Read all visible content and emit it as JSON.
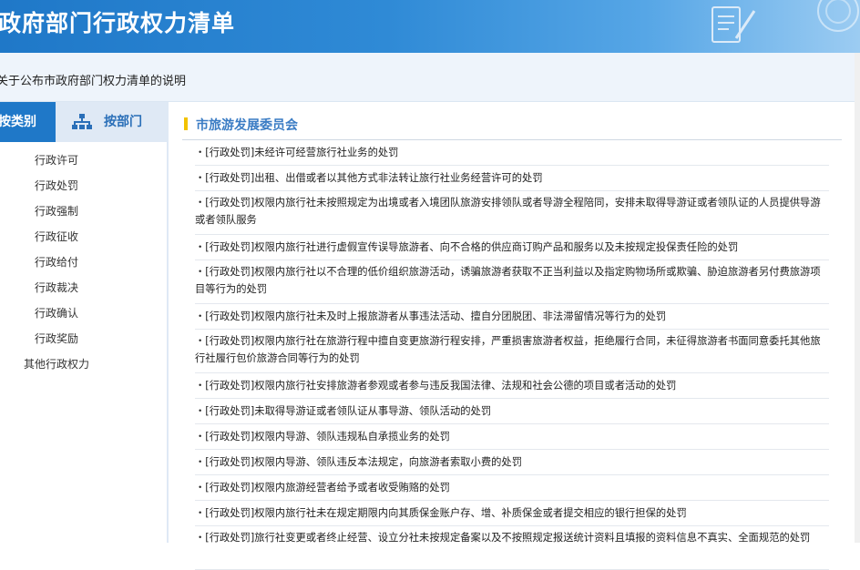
{
  "header": {
    "title": "政府部门行政权力清单"
  },
  "notice": {
    "link_text": "关于公布市政府部门权力清单的说明"
  },
  "tabs": {
    "by_category": "按类别",
    "by_department": "按部门"
  },
  "nav": {
    "items": [
      {
        "label": "行政许可"
      },
      {
        "label": "行政处罚"
      },
      {
        "label": "行政强制"
      },
      {
        "label": "行政征收"
      },
      {
        "label": "行政给付"
      },
      {
        "label": "行政裁决"
      },
      {
        "label": "行政确认"
      },
      {
        "label": "行政奖励"
      },
      {
        "label": "其他行政权力"
      }
    ]
  },
  "main": {
    "section_title": "市旅游发展委员会",
    "items": [
      {
        "text": "・[行政处罚]未经许可经营旅行社业务的处罚"
      },
      {
        "text": "・[行政处罚]出租、出借或者以其他方式非法转让旅行社业务经营许可的处罚"
      },
      {
        "text": "・[行政处罚]权限内旅行社未按照规定为出境或者入境团队旅游安排领队或者导游全程陪同，安排未取得导游证或者领队证的人员提供导游或者领队服务"
      },
      {
        "text": "・[行政处罚]权限内旅行社进行虚假宣传误导旅游者、向不合格的供应商订购产品和服务以及未按规定投保责任险的处罚"
      },
      {
        "text": "・[行政处罚]权限内旅行社以不合理的低价组织旅游活动，诱骗旅游者获取不正当利益以及指定购物场所或欺骗、胁迫旅游者另付费旅游项目等行为的处罚"
      },
      {
        "text": "・[行政处罚]权限内旅行社未及时上报旅游者从事违法活动、擅自分团脱团、非法滞留情况等行为的处罚"
      },
      {
        "text": "・[行政处罚]权限内旅行社在旅游行程中擅自变更旅游行程安排，严重损害旅游者权益，拒绝履行合同，未征得旅游者书面同意委托其他旅行社履行包价旅游合同等行为的处罚"
      },
      {
        "text": "・[行政处罚]权限内旅行社安排旅游者参观或者参与违反我国法律、法规和社会公德的项目或者活动的处罚"
      },
      {
        "text": "・[行政处罚]未取得导游证或者领队证从事导游、领队活动的处罚"
      },
      {
        "text": "・[行政处罚]权限内导游、领队违规私自承揽业务的处罚"
      },
      {
        "text": "・[行政处罚]权限内导游、领队违反本法规定，向旅游者索取小费的处罚"
      },
      {
        "text": "・[行政处罚]权限内旅游经营者给予或者收受贿赂的处罚"
      },
      {
        "text": "・[行政处罚]权限内旅行社未在规定期限内向其质保金账户存、增、补质保金或者提交相应的银行担保的处罚"
      },
      {
        "text": "・[行政处罚]旅行社变更或者终止经营、设立分社未按规定备案以及不按照规定报送统计资料且填报的资料信息不真实、全面规范的处罚"
      }
    ]
  },
  "colors": {
    "brand_blue": "#1f78c8",
    "section_title": "#3a7cc4",
    "accent_yellow": "#f2c200"
  }
}
